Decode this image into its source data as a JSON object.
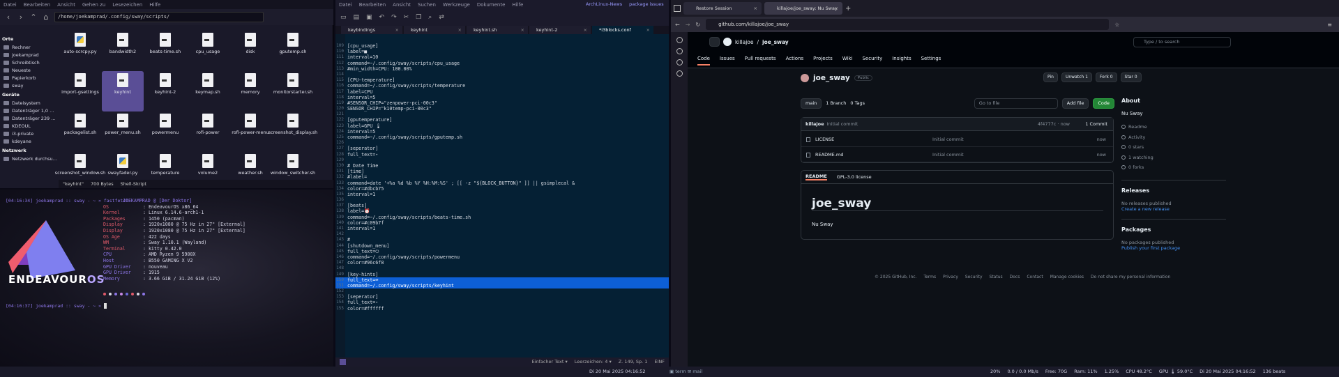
{
  "fm": {
    "menubar": [
      "Datei",
      "Bearbeiten",
      "Ansicht",
      "Gehen zu",
      "Lesezeichen",
      "Hilfe"
    ],
    "path": "/home/joekamprad/.config/sway/scripts/",
    "sidebar": [
      {
        "header": "Orte"
      },
      {
        "label": "Rechner"
      },
      {
        "label": "joekamprad"
      },
      {
        "label": "Schreibtisch"
      },
      {
        "label": "Neueste"
      },
      {
        "label": "Papierkorb"
      },
      {
        "label": "sway"
      },
      {
        "header": "Geräte"
      },
      {
        "label": "Dateisystem"
      },
      {
        "label": "Datenträger 1,0 …"
      },
      {
        "label": "Datenträger 239 …"
      },
      {
        "label": "KDEOUL"
      },
      {
        "label": "i3-private"
      },
      {
        "label": "kdeyane"
      },
      {
        "header": "Netzwerk"
      },
      {
        "label": "Netzwerk durchsu…"
      }
    ],
    "files": [
      {
        "name": "auto-scrcpy.py",
        "type": "py"
      },
      {
        "name": "bandwidth2",
        "type": "sh"
      },
      {
        "name": "beats-time.sh",
        "type": "sh"
      },
      {
        "name": "cpu_usage",
        "type": "sh"
      },
      {
        "name": "disk",
        "type": "sh"
      },
      {
        "name": "gputemp.sh",
        "type": "sh"
      },
      {
        "name": "import-gsettings",
        "type": "sh"
      },
      {
        "name": "keyhint",
        "type": "sh",
        "selected": true
      },
      {
        "name": "keyhint-2",
        "type": "sh"
      },
      {
        "name": "keymap.sh",
        "type": "sh"
      },
      {
        "name": "memory",
        "type": "sh"
      },
      {
        "name": "monitorstarter.sh",
        "type": "sh"
      },
      {
        "name": "packagelist.sh",
        "type": "sh"
      },
      {
        "name": "power_menu.sh",
        "type": "sh"
      },
      {
        "name": "powermenu",
        "type": "sh"
      },
      {
        "name": "rofi-power",
        "type": "sh"
      },
      {
        "name": "rofi-power-menu",
        "type": "sh"
      },
      {
        "name": "screenshot_display.sh",
        "type": "sh"
      },
      {
        "name": "screenshot_window.sh",
        "type": "sh"
      },
      {
        "name": "swayfader.py",
        "type": "py"
      },
      {
        "name": "temperature",
        "type": "sh"
      },
      {
        "name": "volume2",
        "type": "sh"
      },
      {
        "name": "weather.sh",
        "type": "sh"
      },
      {
        "name": "window_switcher.sh",
        "type": "sh"
      }
    ],
    "status": {
      "name": "\"keyhint\"",
      "size": "700 Bytes",
      "type": "Shell-Skript"
    }
  },
  "term": {
    "prompt1": "[04:16:34] joekamprad :: sway - ~ » fastfetch",
    "prompt2": "[04:16:37] joekamprad :: sway - ~ » ",
    "logo_text_a": "ENDEAVOUR",
    "logo_text_b": "OS",
    "user_host": "JOEKAMPRAD @ [Der Doktor]",
    "info": [
      {
        "k": "OS",
        "v": ": EndeavourOS x86_64",
        "c": "r"
      },
      {
        "k": "Kernel",
        "v": ": Linux 6.14.6-arch1-1",
        "c": "r"
      },
      {
        "k": "Packages",
        "v": ": 1450 (pacman)",
        "c": "r"
      },
      {
        "k": "Display",
        "v": ": 1920x1080 @ 75 Hz in 27\" [External]",
        "c": "r"
      },
      {
        "k": "Display",
        "v": ": 1920x1080 @ 75 Hz in 27\" [External]",
        "c": "r"
      },
      {
        "k": "OS Age",
        "v": ": 422 days",
        "c": "r"
      },
      {
        "k": "WM",
        "v": ": Sway 1.10.1 (Wayland)",
        "c": "r"
      },
      {
        "k": "Terminal",
        "v": ": kitty 0.42.0",
        "c": "r"
      },
      {
        "k": "CPU",
        "v": ": AMD Ryzen 9 5900X",
        "c": "p"
      },
      {
        "k": "Host",
        "v": ": B550 GAMING X V2",
        "c": "p"
      },
      {
        "k": "GPU Driver",
        "v": ": nouveau",
        "c": "p"
      },
      {
        "k": "GPU Driver",
        "v": ": 1915",
        "c": "p"
      },
      {
        "k": "Memory",
        "v": ": 3.66 GiB / 31.24 GiB (12%)",
        "c": "p"
      }
    ],
    "dots": [
      "#e05a6a",
      "#d9d9e6",
      "#8d76e8",
      "#c78ae6",
      "#6a6ad9",
      "#e05a6a",
      "#d9d9e6",
      "#8d76e8"
    ]
  },
  "editor": {
    "menubar": [
      "Datei",
      "Bearbeiten",
      "Ansicht",
      "Suchen",
      "Werkzeuge",
      "Dokumente",
      "Hilfe"
    ],
    "tabs": [
      {
        "label": "keybindings"
      },
      {
        "label": "keyhint"
      },
      {
        "label": "keyhint.sh"
      },
      {
        "label": "keyhint-2"
      },
      {
        "label": "*i3blocks.conf",
        "active": true
      }
    ],
    "lines": [
      {
        "n": "109",
        "t": "[cpu_usage]"
      },
      {
        "n": "110",
        "t": "label=■"
      },
      {
        "n": "111",
        "t": "interval=10"
      },
      {
        "n": "112",
        "t": "command=~/.config/sway/scripts/cpu_usage"
      },
      {
        "n": "113",
        "t": "#min_width=CPU: 100.00%"
      },
      {
        "n": "114",
        "t": ""
      },
      {
        "n": "115",
        "t": "[CPU-temperature]"
      },
      {
        "n": "116",
        "t": "command=~/.config/sway/scripts/temperature"
      },
      {
        "n": "117",
        "t": "label=CPU"
      },
      {
        "n": "118",
        "t": "interval=5"
      },
      {
        "n": "119",
        "t": "#SENSOR_CHIP=\"zenpower-pci-00c3\""
      },
      {
        "n": "120",
        "t": "SENSOR_CHIP=\"k10temp-pci-00c3\""
      },
      {
        "n": "121",
        "t": ""
      },
      {
        "n": "122",
        "t": "[gputemperature]"
      },
      {
        "n": "123",
        "t": "label=GPU 🌡"
      },
      {
        "n": "124",
        "t": "interval=5"
      },
      {
        "n": "125",
        "t": "command=~/.config/sway/scripts/gputemp.sh"
      },
      {
        "n": "126",
        "t": ""
      },
      {
        "n": "127",
        "t": "[seperator]"
      },
      {
        "n": "128",
        "t": "full_text=⋆"
      },
      {
        "n": "129",
        "t": ""
      },
      {
        "n": "130",
        "t": "# Date Time"
      },
      {
        "n": "131",
        "t": "[time]"
      },
      {
        "n": "132",
        "t": "#label="
      },
      {
        "n": "133",
        "t": "command=date '+%a %d %b %Y %H:%M:%S' ; [[ -z \"${BLOCK_BUTTON}\" ]] || gsimplecal &"
      },
      {
        "n": "134",
        "t": "color=#dbcb75"
      },
      {
        "n": "135",
        "t": "interval=1"
      },
      {
        "n": "136",
        "t": ""
      },
      {
        "n": "137",
        "t": "[beats]"
      },
      {
        "n": "138",
        "t": "label=⏰"
      },
      {
        "n": "139",
        "t": "command=~/.config/sway/scripts/beats-time.sh"
      },
      {
        "n": "140",
        "t": "color=#c09b7f"
      },
      {
        "n": "141",
        "t": "interval=1"
      },
      {
        "n": "142",
        "t": ""
      },
      {
        "n": "143",
        "t": "#"
      },
      {
        "n": "144",
        "t": "[shutdown_menu]"
      },
      {
        "n": "145",
        "t": "full_text=⏻"
      },
      {
        "n": "146",
        "t": "command=~/.config/sway/scripts/powermenu"
      },
      {
        "n": "147",
        "t": "color=#96c6f8"
      },
      {
        "n": "148",
        "t": ""
      },
      {
        "n": "149",
        "t": "[key-hints]"
      },
      {
        "n": "150",
        "t": "full_text=⌨",
        "hl": true
      },
      {
        "n": "151",
        "t": "command=~/.config/sway/scripts/keyhint",
        "hl": true
      },
      {
        "n": "152",
        "t": ""
      },
      {
        "n": "153",
        "t": "[seperator]"
      },
      {
        "n": "154",
        "t": "full_text=⋆"
      },
      {
        "n": "155",
        "t": "color=#ffffff"
      }
    ],
    "status": {
      "mode": "Einfacher Text ▾",
      "indent": "Leerzeichen: 4 ▾",
      "pos": "Z. 149, Sp. 1",
      "ins": "EINF"
    }
  },
  "browser": {
    "tabs": [
      {
        "label": "Restore Session"
      },
      {
        "label": "killajoe/joe_sway: Nu Sway",
        "active": true
      }
    ],
    "top_links": [
      "ArchLinux-News",
      "package issues"
    ],
    "url": "github.com/killajoe/joe_sway",
    "gh": {
      "owner": "killajoe",
      "repo": "joe_sway",
      "search_placeholder": "Type / to search",
      "nav": [
        "Code",
        "Issues",
        "Pull requests",
        "Actions",
        "Projects",
        "Wiki",
        "Security",
        "Insights",
        "Settings"
      ],
      "visibility": "Public",
      "actions": [
        "Pin",
        "Unwatch 1",
        "Fork 0",
        "Star 0"
      ],
      "branch": "main",
      "branches": "1 Branch",
      "tags": "0 Tags",
      "goto": "Go to file",
      "addfile": "Add file",
      "code": "Code",
      "commit": {
        "author": "killajoe",
        "msg": "Initial commit",
        "hash": "4f4777c · now",
        "count": "1 Commit"
      },
      "files": [
        {
          "name": "LICENSE",
          "msg": "Initial commit",
          "time": "now"
        },
        {
          "name": "README.md",
          "msg": "Initial commit",
          "time": "now"
        }
      ],
      "readme_tabs": [
        "README",
        "GPL-3.0 license"
      ],
      "readme_title": "joe_sway",
      "readme_text": "Nu Sway",
      "about": {
        "title": "About",
        "desc": "Nu Sway",
        "items": [
          "Readme",
          "Activity",
          "0 stars",
          "1 watching",
          "0 forks"
        ],
        "releases_h": "Releases",
        "releases": "No releases published",
        "releases_link": "Create a new release",
        "packages_h": "Packages",
        "packages": "No packages published",
        "packages_link": "Publish your first package"
      },
      "footer": [
        "© 2025 GitHub, Inc.",
        "Terms",
        "Privacy",
        "Security",
        "Status",
        "Docs",
        "Contact",
        "Manage cookies",
        "Do not share my personal information"
      ]
    }
  },
  "taskbar": {
    "left_clock": "Di 20 Mai 2025 04:16:52",
    "mid_clock": "Di 20 Mai 2025 04:16:52",
    "ws_icons": [
      "term",
      "mail"
    ],
    "right": [
      "20%",
      "0.0 / 0.0 Mb/s",
      "Free: 70G",
      "Ram: 11%",
      "1.25%",
      "CPU 48.2°C",
      "GPU 🌡 59.0°C",
      "Di 20 Mai 2025 04:16:52",
      "136 beats"
    ]
  },
  "colors": {
    "accent": "#5a4e96",
    "gh_green": "#238636",
    "highlight": "#0d5fd6"
  }
}
